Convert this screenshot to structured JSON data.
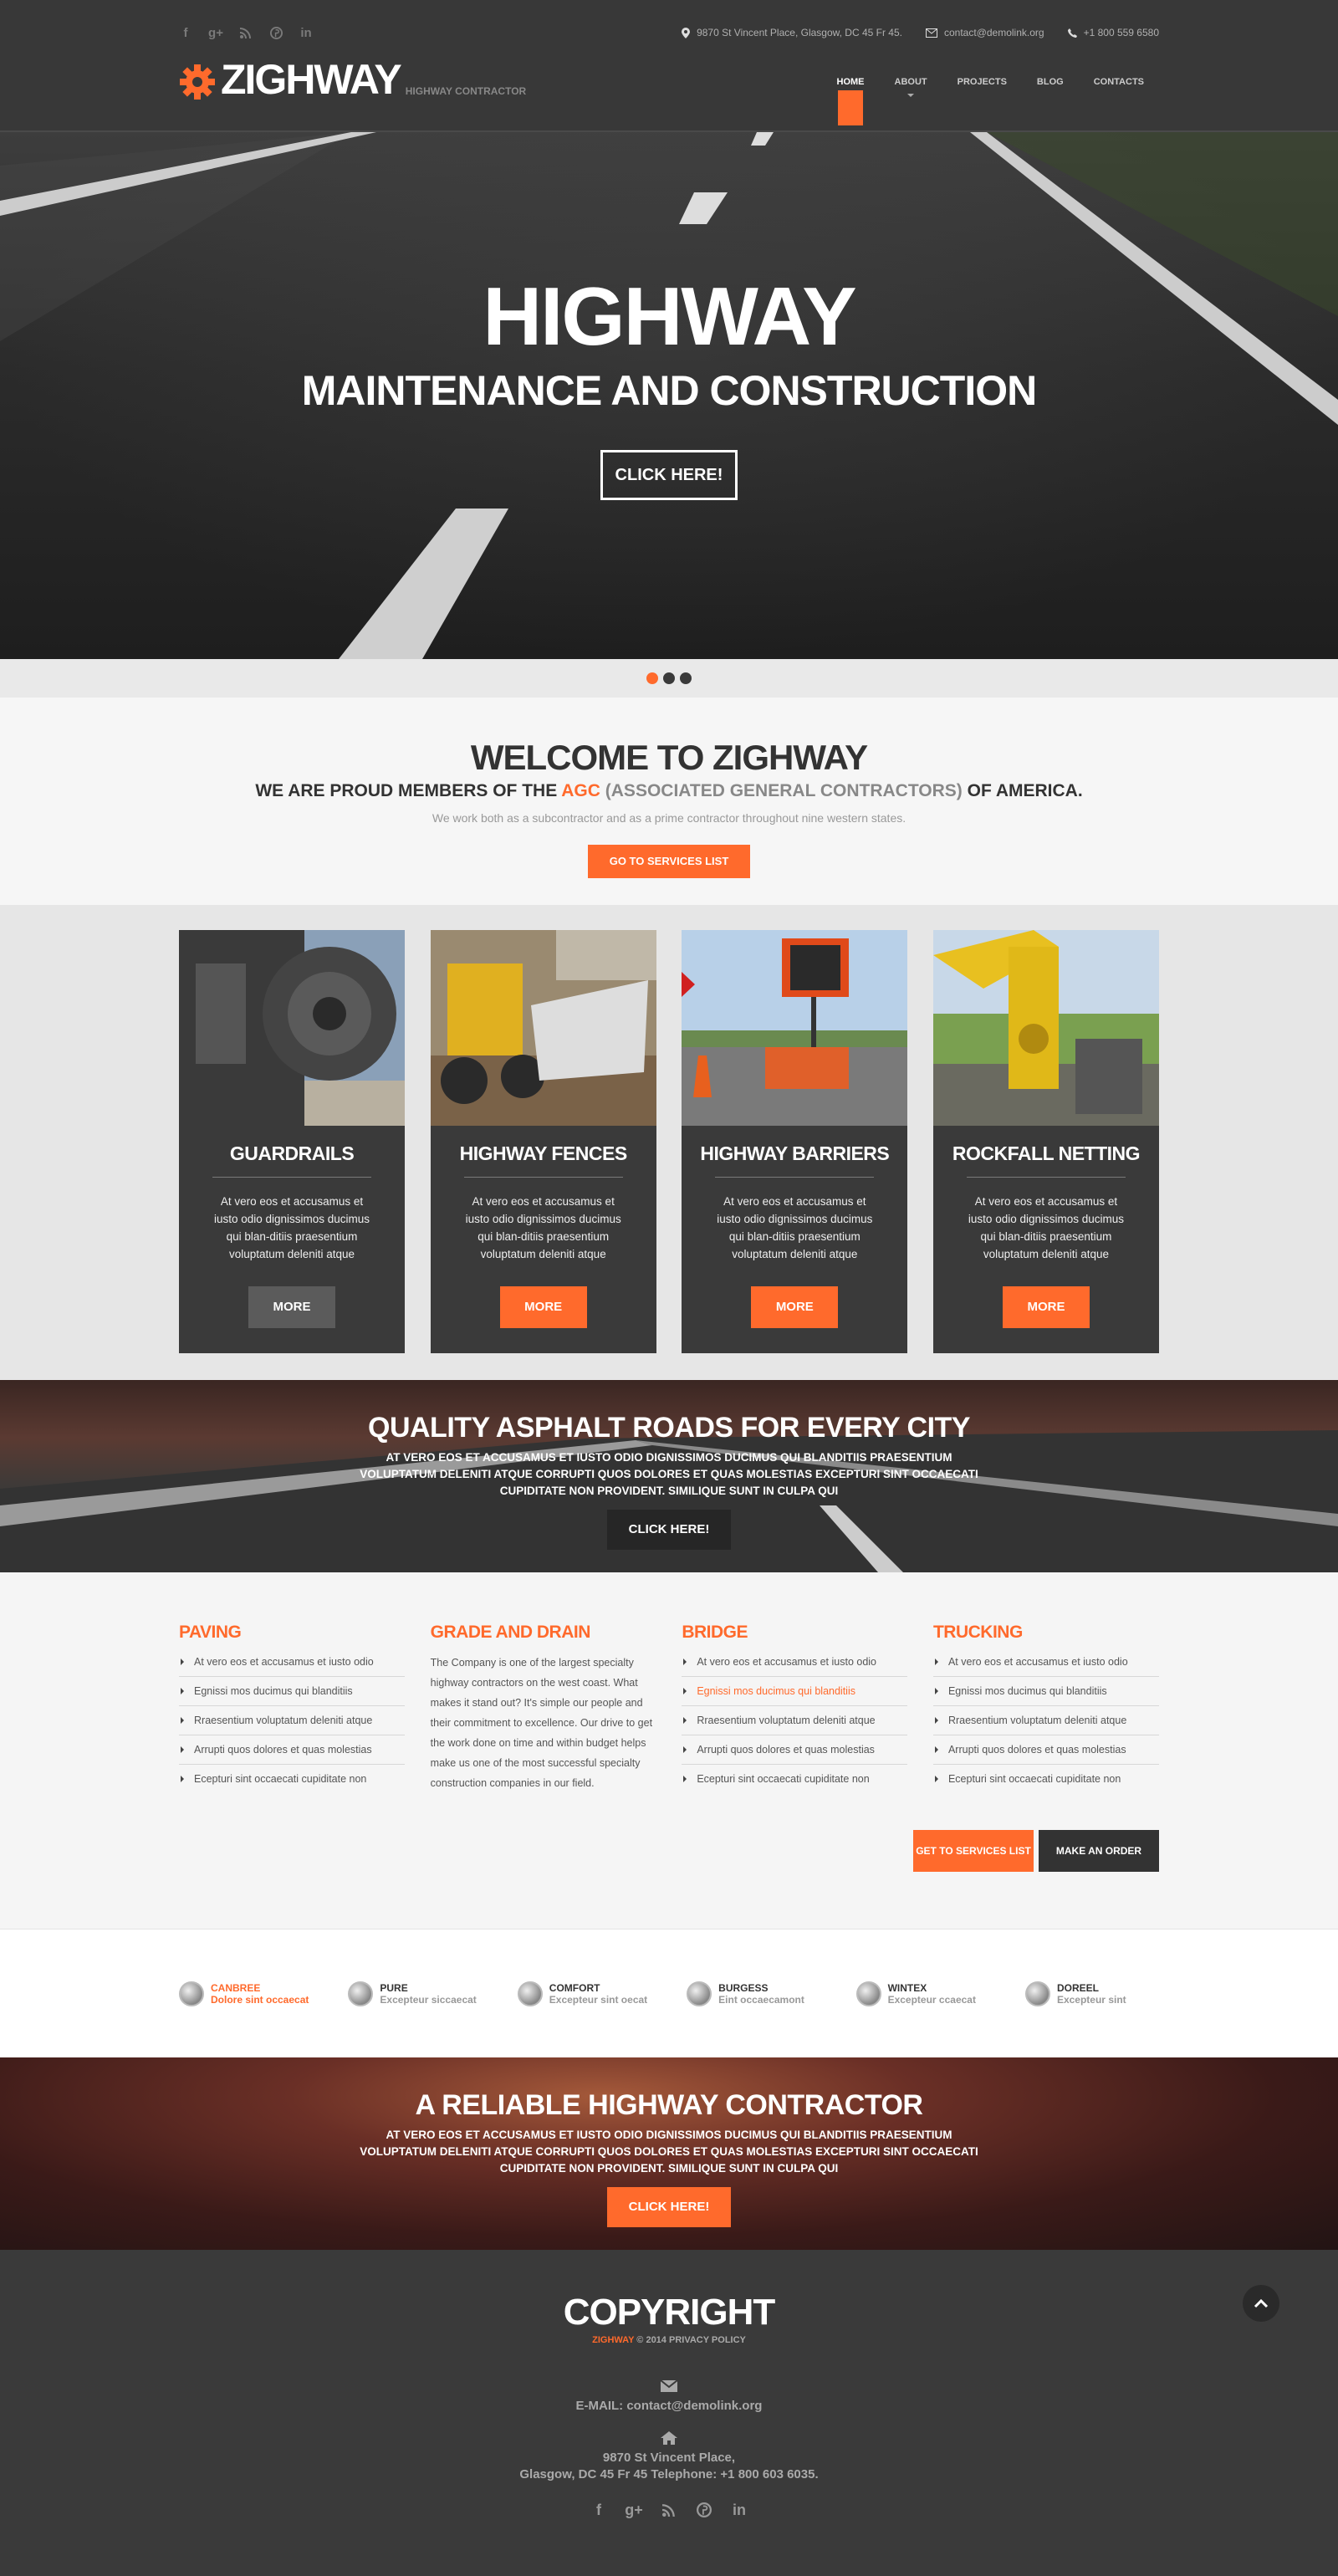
{
  "header": {
    "socials": [
      "facebook-icon",
      "google-plus-icon",
      "rss-icon",
      "pinterest-icon",
      "linkedin-icon"
    ],
    "address": "9870 St Vincent Place, Glasgow, DC 45 Fr 45.",
    "email": "contact@demolink.org",
    "phone": "+1 800 559 6580",
    "logo_name": "ZIGHWAY",
    "logo_tagline": "HIGHWAY CONTRACTOR",
    "nav": [
      "HOME",
      "ABOUT",
      "PROJECTS",
      "BLOG",
      "CONTACTS"
    ],
    "accent": "#ff6a2c"
  },
  "hero": {
    "title": "HIGHWAY",
    "subtitle": "MAINTENANCE AND CONSTRUCTION",
    "button": "CLICK HERE!"
  },
  "welcome": {
    "title": "WELCOME TO ZIGHWAY",
    "sub_pre": "WE ARE PROUD MEMBERS OF THE ",
    "sub_agc": "AGC",
    "sub_assoc": " (ASSOCIATED GENERAL CONTRACTORS)",
    "sub_post": " OF AMERICA.",
    "text": "We work both as a subcontractor and as a prime contractor throughout nine western states.",
    "button": "GO TO SERVICES LIST"
  },
  "services": [
    {
      "title": "GUARDRAILS",
      "text": "At vero eos et accusamus et iusto odio dignissimos ducimus qui blan-ditiis praesentium voluptatum deleniti atque",
      "button": "MORE"
    },
    {
      "title": "HIGHWAY FENCES",
      "text": "At vero eos et accusamus et iusto odio dignissimos ducimus qui blan-ditiis praesentium voluptatum deleniti atque",
      "button": "MORE"
    },
    {
      "title": "HIGHWAY BARRIERS",
      "text": "At vero eos et accusamus et iusto odio dignissimos ducimus qui blan-ditiis praesentium voluptatum deleniti atque",
      "button": "MORE"
    },
    {
      "title": "ROCKFALL NETTING",
      "text": "At vero eos et accusamus et iusto odio dignissimos ducimus qui blan-ditiis praesentium voluptatum deleniti atque",
      "button": "MORE"
    }
  ],
  "quality": {
    "title": "QUALITY ASPHALT ROADS FOR EVERY CITY",
    "text": "AT VERO EOS ET ACCUSAMUS ET IUSTO ODIO DIGNISSIMOS DUCIMUS QUI BLANDITIIS PRAESENTIUM VOLUPTATUM DELENITI ATQUE CORRUPTI QUOS DOLORES ET QUAS MOLESTIAS EXCEPTURI SINT OCCAECATI CUPIDITATE NON PROVIDENT. SIMILIQUE SUNT IN CULPA QUI",
    "button": "CLICK HERE!"
  },
  "columns": {
    "paving": {
      "title": "PAVING",
      "items": [
        "At vero eos et accusamus et iusto odio",
        "Egnissi mos ducimus qui blanditiis",
        "Rraesentium voluptatum deleniti atque",
        "Arrupti quos dolores et quas molestias",
        "Ecepturi sint occaecati cupiditate non"
      ]
    },
    "grade": {
      "title": "GRADE AND DRAIN",
      "text": "The Company is one of the largest specialty highway contractors on the west coast. What makes it stand out? It's simple our people and their commitment to excellence. Our drive to get the work done on time and within budget helps make us one of the most successful specialty construction companies in our field."
    },
    "bridge": {
      "title": "BRIDGE",
      "items": [
        "At vero eos et accusamus et iusto odio",
        "Egnissi mos ducimus qui blanditiis",
        "Rraesentium voluptatum deleniti atque",
        "Arrupti quos dolores et quas molestias",
        "Ecepturi sint occaecati cupiditate non"
      ]
    },
    "trucking": {
      "title": "TRUCKING",
      "items": [
        "At vero eos et accusamus et iusto odio",
        "Egnissi mos ducimus qui blanditiis",
        "Rraesentium voluptatum deleniti atque",
        "Arrupti quos dolores et quas molestias",
        "Ecepturi sint occaecati cupiditate non"
      ]
    },
    "btn_services": "GET TO SERVICES LIST",
    "btn_order": "MAKE AN ORDER"
  },
  "partners": [
    {
      "name": "CANBREE",
      "text": "Dolore sint occaecat"
    },
    {
      "name": "PURE",
      "text": "Excepteur siccaecat"
    },
    {
      "name": "COMFORT",
      "text": "Excepteur sint oecat"
    },
    {
      "name": "BURGESS",
      "text": "Eint occaecamont"
    },
    {
      "name": "WINTEX",
      "text": "Excepteur ccaecat"
    },
    {
      "name": "DOREEL",
      "text": "Excepteur sint"
    }
  ],
  "reliable": {
    "title": "A RELIABLE HIGHWAY CONTRACTOR",
    "text": "AT VERO EOS ET ACCUSAMUS ET IUSTO ODIO DIGNISSIMOS DUCIMUS QUI BLANDITIIS PRAESENTIUM VOLUPTATUM DELENITI ATQUE CORRUPTI QUOS DOLORES ET QUAS MOLESTIAS EXCEPTURI SINT OCCAECATI CUPIDITATE NON PROVIDENT. SIMILIQUE SUNT IN CULPA QUI",
    "button": "CLICK HERE!"
  },
  "footer": {
    "title": "COPYRIGHT",
    "brand": "ZIGHWAY",
    "year": " © 2014 ",
    "privacy": "PRIVACY POLICY",
    "email_label": "E-MAIL: ",
    "email": "contact@demolink.org",
    "address1": "9870 St Vincent Place,",
    "address2": "Glasgow, DC 45 Fr 45 Telephone: +1 800 603 6035."
  }
}
